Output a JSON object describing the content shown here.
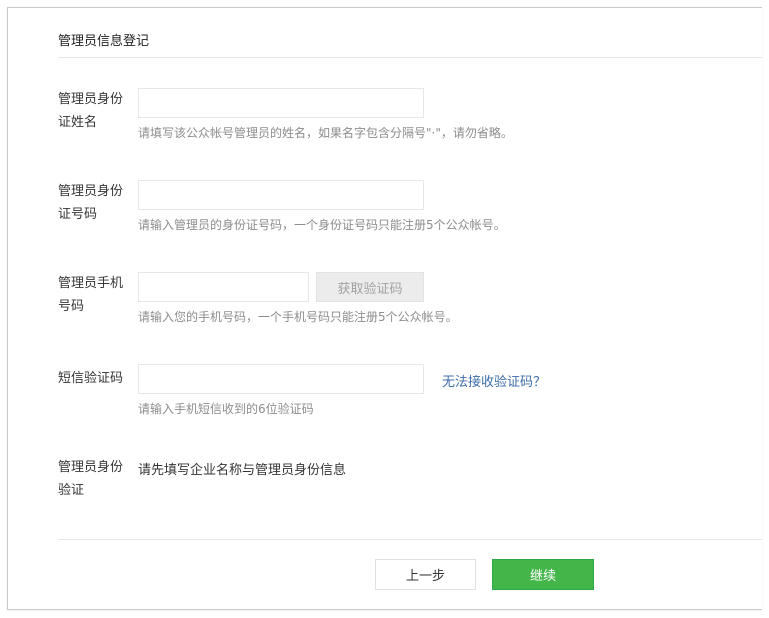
{
  "section": {
    "title": "管理员信息登记"
  },
  "fields": {
    "id_name": {
      "label": "管理员身份证姓名",
      "value": "",
      "hint": "请填写该公众帐号管理员的姓名，如果名字包含分隔号\"·\"，请勿省略。"
    },
    "id_number": {
      "label": "管理员身份证号码",
      "value": "",
      "hint": "请输入管理员的身份证号码，一个身份证号码只能注册5个公众帐号。"
    },
    "phone": {
      "label": "管理员手机号码",
      "value": "",
      "hint": "请输入您的手机号码，一个手机号码只能注册5个公众帐号。",
      "get_code_label": "获取验证码"
    },
    "sms_code": {
      "label": "短信验证码",
      "value": "",
      "hint": "请输入手机短信收到的6位验证码",
      "help_link": "无法接收验证码？"
    },
    "identity_verify": {
      "label": "管理员身份验证",
      "text": "请先填写企业名称与管理员身份信息"
    }
  },
  "footer": {
    "prev_label": "上一步",
    "next_label": "继续"
  },
  "colors": {
    "primary_button": "#44b549",
    "link": "#3c6ea8",
    "hint_text": "#8d8d8d",
    "disabled_button_bg": "#ececec"
  }
}
